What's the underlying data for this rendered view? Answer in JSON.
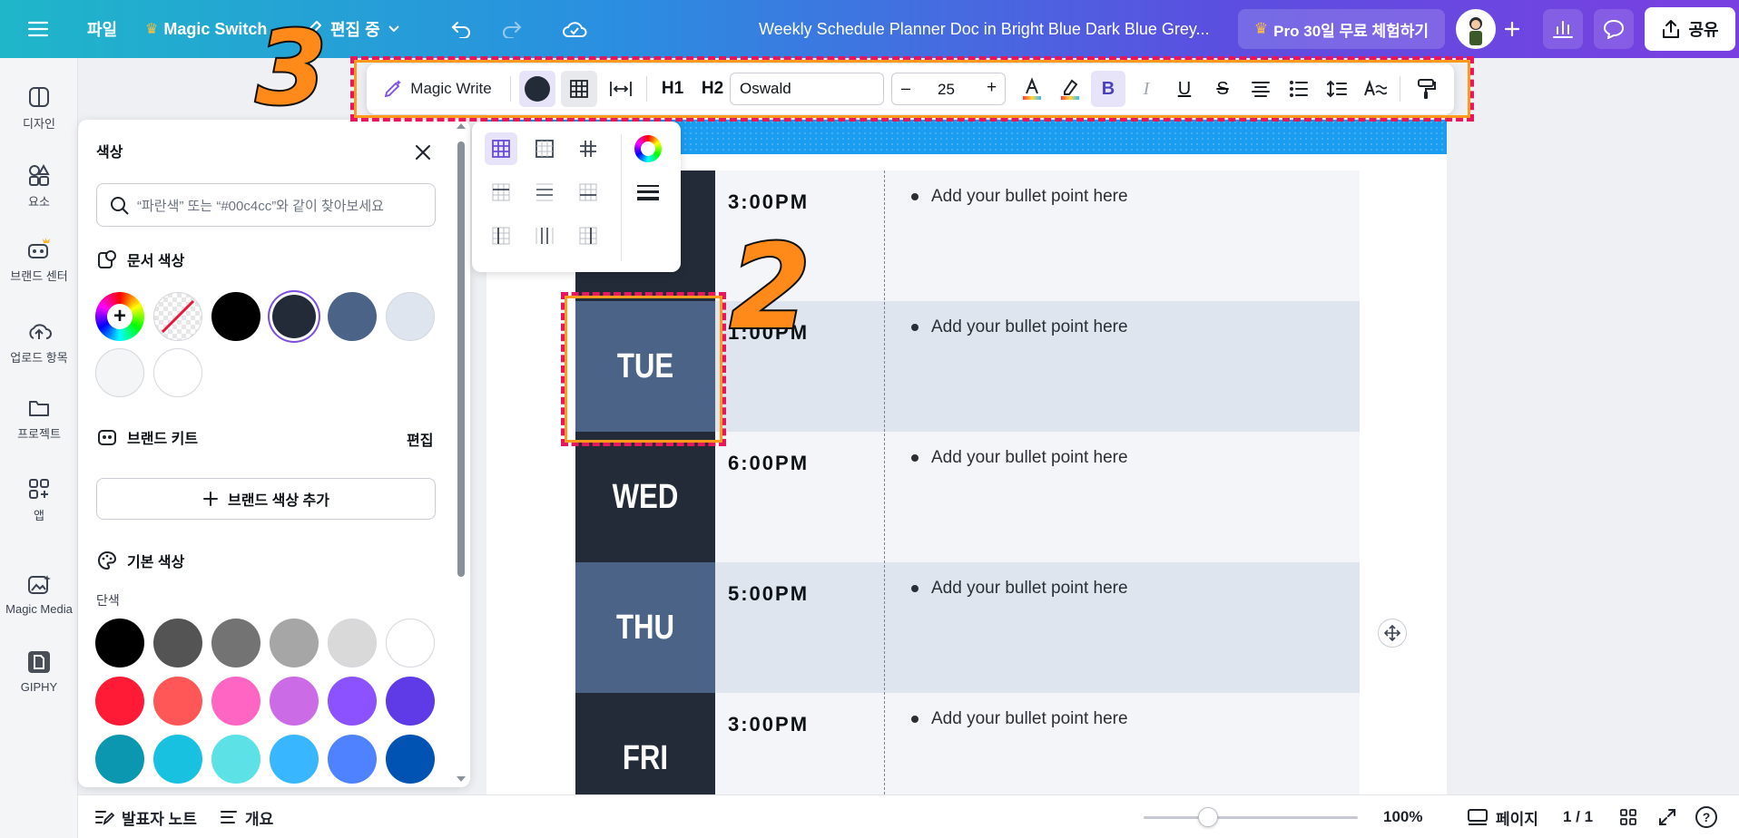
{
  "topbar": {
    "file_label": "파일",
    "magic_switch_label": "Magic Switch",
    "editing_label": "편집 중",
    "doc_title": "Weekly Schedule Planner Doc in Bright Blue Dark Blue Grey...",
    "pro_trial_label": "Pro 30일 무료 체험하기",
    "share_label": "공유"
  },
  "rail": {
    "items": [
      {
        "label": "디자인",
        "icon": "design-icon"
      },
      {
        "label": "요소",
        "icon": "elements-icon"
      },
      {
        "label": "브랜드 센터",
        "icon": "brand-center-icon"
      },
      {
        "label": "업로드 항목",
        "icon": "upload-icon"
      },
      {
        "label": "프로젝트",
        "icon": "folder-icon"
      },
      {
        "label": "앱",
        "icon": "apps-icon"
      },
      {
        "label": "Magic Media",
        "icon": "magic-media-icon"
      },
      {
        "label": "GIPHY",
        "icon": "giphy-icon"
      }
    ]
  },
  "color_panel": {
    "title": "색상",
    "search_placeholder": "“파란색” 또는 “#00c4cc”와 같이 찾아보세요",
    "document_colors_title": "문서 색상",
    "document_colors": [
      "#000000",
      "#232b38",
      "#4a6386",
      "#dfe5ee",
      "#f4f5f7",
      "#ffffff"
    ],
    "selected_color": "#232b38",
    "brand_kit_title": "브랜드 키트",
    "brand_kit_edit": "편집",
    "add_brand_color": "브랜드 색상 추가",
    "default_colors_title": "기본 색상",
    "solid_label": "단색",
    "default_colors": [
      "#000000",
      "#545454",
      "#737373",
      "#a6a6a6",
      "#d9d9d9",
      "#ffffff",
      "#ff1a35",
      "#ff5757",
      "#ff66c4",
      "#cb6ce6",
      "#8c52ff",
      "#5e3be6",
      "#0c97b1",
      "#18c1e0",
      "#5ce1e6",
      "#38b6ff",
      "#4f82ff",
      "#0153b3"
    ]
  },
  "toolbar": {
    "magic_write": "Magic Write",
    "h1": "H1",
    "h2": "H2",
    "font_name": "Oswald",
    "font_size": "25",
    "minus": "–",
    "plus": "+",
    "bold": "B",
    "italic": "I",
    "underline": "U",
    "strike": "S"
  },
  "schedule": {
    "rows": [
      {
        "day": "",
        "time": "3:00PM",
        "bullet": "Add your bullet point here"
      },
      {
        "day": "TUE",
        "time": "1:00PM",
        "bullet": "Add your bullet point here"
      },
      {
        "day": "WED",
        "time": "6:00PM",
        "bullet": "Add your bullet point here"
      },
      {
        "day": "THU",
        "time": "5:00PM",
        "bullet": "Add your bullet point here"
      },
      {
        "day": "FRI",
        "time": "3:00PM",
        "bullet": "Add your bullet point here"
      }
    ]
  },
  "annotations": {
    "num_2": "2",
    "num_3": "3"
  },
  "bottombar": {
    "notes_label": "발표자 노트",
    "outline_label": "개요",
    "zoom_label": "100%",
    "zoom_value": 0.3,
    "pages_label": "페이지",
    "page_count": "1 / 1",
    "help_label": "?"
  },
  "colors": {
    "dark_navy": "#232b38",
    "slate_blue": "#4a6386",
    "light_row": "#dfe5ee",
    "pale_row": "#f3f5f8",
    "accent_purple": "#7d4fe0"
  }
}
